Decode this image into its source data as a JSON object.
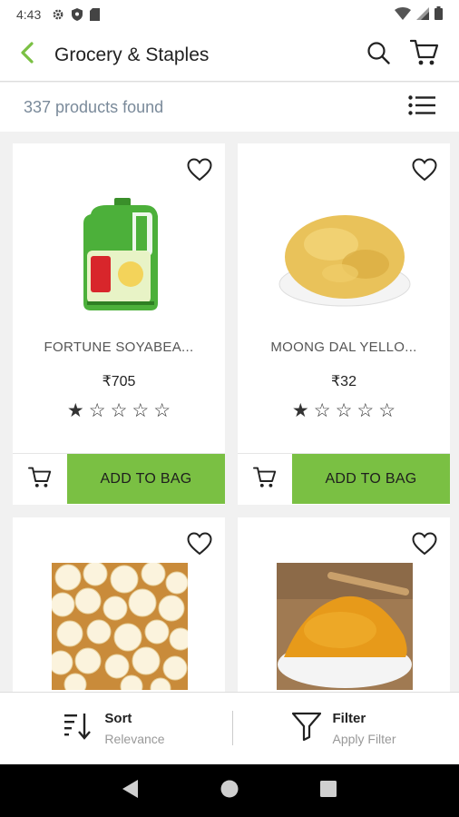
{
  "status_bar": {
    "time": "4:43"
  },
  "app_bar": {
    "title": "Grocery & Staples"
  },
  "results": {
    "count_text": "337 products found"
  },
  "products": [
    {
      "name": "FORTUNE SOYABEA...",
      "price": "₹705",
      "rating": 1,
      "max_rating": 5,
      "button": "ADD TO BAG",
      "image": "oil-can-image"
    },
    {
      "name": "MOONG DAL YELLO...",
      "price": "₹32",
      "rating": 1,
      "max_rating": 5,
      "button": "ADD TO BAG",
      "image": "dal-bowl-image"
    },
    {
      "name": "",
      "price": "",
      "image": "popcorn-image"
    },
    {
      "name": "",
      "price": "",
      "image": "turmeric-image"
    }
  ],
  "bottom_bar": {
    "sort": {
      "label": "Sort",
      "value": "Relevance"
    },
    "filter": {
      "label": "Filter",
      "value": "Apply Filter"
    }
  },
  "colors": {
    "accent": "#7ac043",
    "background": "#f1f1f1"
  }
}
